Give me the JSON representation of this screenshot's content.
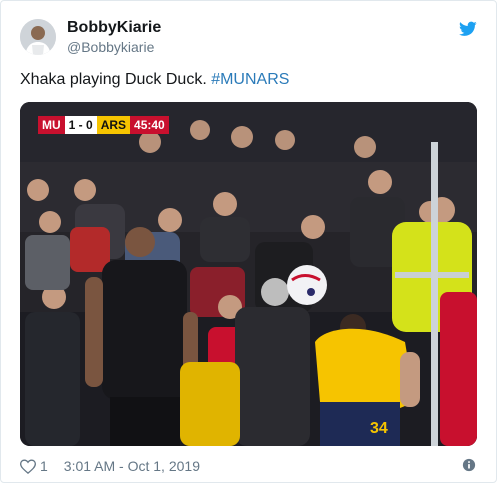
{
  "tweet": {
    "display_name": "BobbyKiarie",
    "handle": "@Bobbykiarie",
    "text": "Xhaka playing Duck Duck. ",
    "hashtag": "#MUNARS",
    "like_count": "1",
    "timestamp": "3:01 AM - Oct 1, 2019"
  },
  "media": {
    "scoreboard": {
      "home": "MU",
      "score": "1 - 0",
      "away": "ARS",
      "time": "45:40"
    },
    "shirt_number": "34"
  },
  "colors": {
    "name": "#14171a",
    "secondary_text": "#657786",
    "hashtag": "#2b7bb9",
    "twitter_blue": "#1da1f2",
    "united_red": "#c8102e",
    "arsenal_yellow": "#f6c400"
  },
  "icons": {
    "brand": "twitter-bird-icon",
    "like": "heart-outline-icon",
    "info": "info-icon"
  }
}
